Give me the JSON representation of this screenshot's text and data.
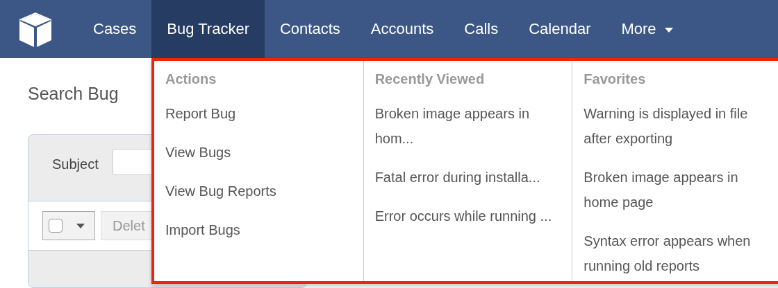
{
  "nav": {
    "tabs": [
      {
        "label": "Cases",
        "selected": false,
        "kind": "link"
      },
      {
        "label": "Bug Tracker",
        "selected": true,
        "kind": "link"
      },
      {
        "label": "Contacts",
        "selected": false,
        "kind": "link"
      },
      {
        "label": "Accounts",
        "selected": false,
        "kind": "link"
      },
      {
        "label": "Calls",
        "selected": false,
        "kind": "link"
      },
      {
        "label": "Calendar",
        "selected": false,
        "kind": "link"
      },
      {
        "label": "More",
        "selected": false,
        "kind": "dropdown"
      }
    ]
  },
  "page": {
    "heading": "Search Bug",
    "filter": {
      "label": "Subject"
    },
    "toolbar": {
      "select_all_checked": false,
      "action": "Delet"
    }
  },
  "menu": {
    "columns": [
      {
        "title": "Actions",
        "items": [
          "Report Bug",
          "View Bugs",
          "View Bug Reports",
          "Import Bugs"
        ]
      },
      {
        "title": "Recently Viewed",
        "items": [
          "Broken image appears in hom...",
          "Fatal error during installa...",
          "Error occurs while running ..."
        ]
      },
      {
        "title": "Favorites",
        "items": [
          "Warning is displayed in file after exporting",
          "Broken image appears in home page",
          "Syntax error appears when running old reports"
        ]
      }
    ]
  }
}
